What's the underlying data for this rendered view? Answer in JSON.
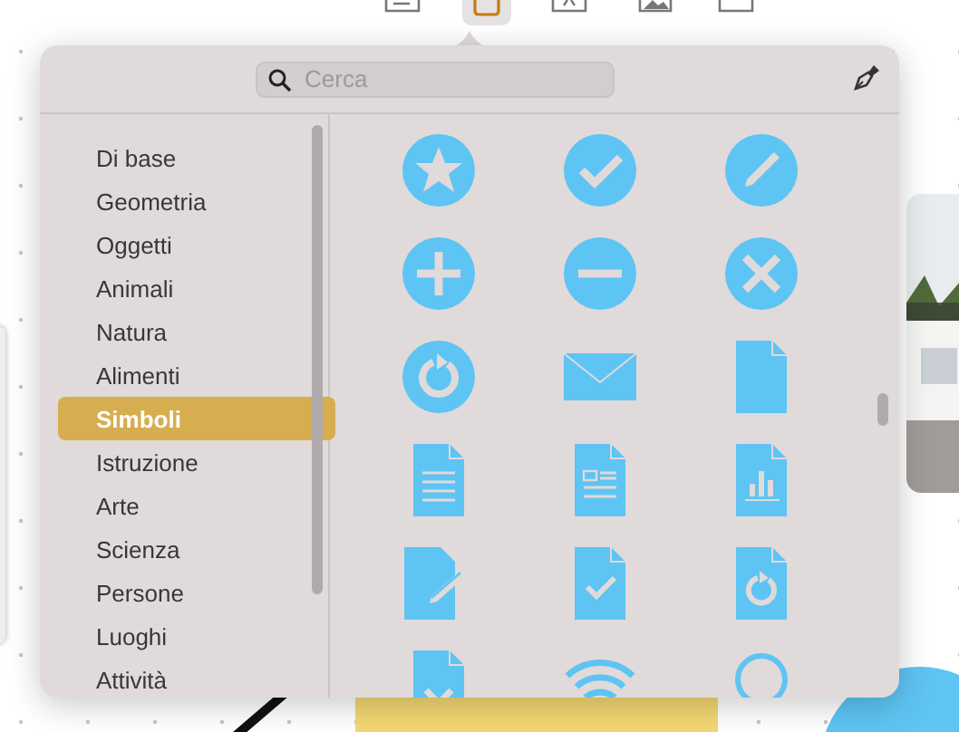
{
  "toolbar": [
    {
      "kind": "table",
      "selected": false
    },
    {
      "kind": "shape",
      "selected": true
    },
    {
      "kind": "text",
      "selected": false
    },
    {
      "kind": "media",
      "selected": false
    },
    {
      "kind": "comment",
      "selected": false
    }
  ],
  "search": {
    "placeholder": "Cerca"
  },
  "categories": [
    {
      "label": "Di base",
      "selected": false
    },
    {
      "label": "Geometria",
      "selected": false
    },
    {
      "label": "Oggetti",
      "selected": false
    },
    {
      "label": "Animali",
      "selected": false
    },
    {
      "label": "Natura",
      "selected": false
    },
    {
      "label": "Alimenti",
      "selected": false
    },
    {
      "label": "Simboli",
      "selected": true
    },
    {
      "label": "Istruzione",
      "selected": false
    },
    {
      "label": "Arte",
      "selected": false
    },
    {
      "label": "Scienza",
      "selected": false
    },
    {
      "label": "Persone",
      "selected": false
    },
    {
      "label": "Luoghi",
      "selected": false
    },
    {
      "label": "Attività",
      "selected": false
    }
  ],
  "shapes": [
    {
      "kind": "star-circle"
    },
    {
      "kind": "check-circle"
    },
    {
      "kind": "pencil-circle"
    },
    {
      "kind": "plus-circle"
    },
    {
      "kind": "minus-circle"
    },
    {
      "kind": "cross-circle"
    },
    {
      "kind": "refresh-circle"
    },
    {
      "kind": "envelope"
    },
    {
      "kind": "document"
    },
    {
      "kind": "text-document"
    },
    {
      "kind": "layout-document"
    },
    {
      "kind": "chart-document"
    },
    {
      "kind": "pencil-document"
    },
    {
      "kind": "check-document"
    },
    {
      "kind": "refresh-document"
    },
    {
      "kind": "cross-document"
    },
    {
      "kind": "wifi"
    },
    {
      "kind": "ring"
    }
  ]
}
